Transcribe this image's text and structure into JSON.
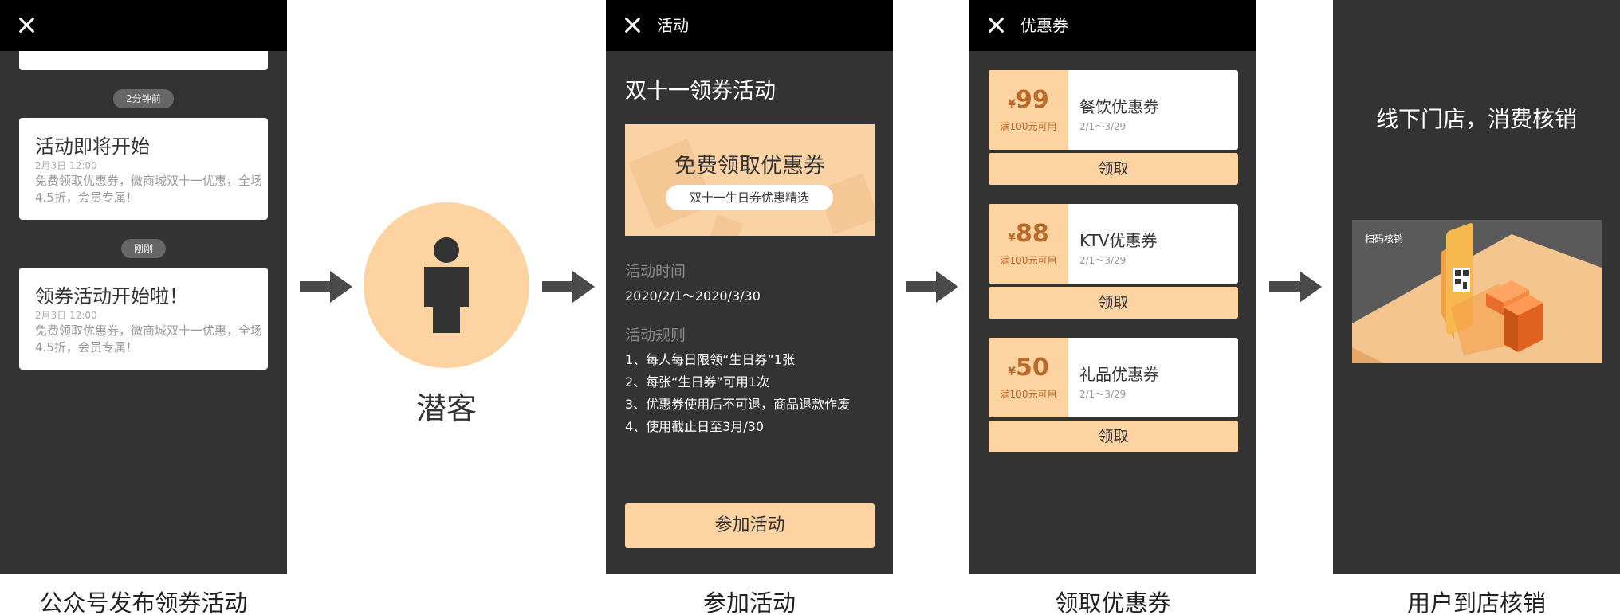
{
  "panel1": {
    "pill_1": "2分钟前",
    "pill_2": "刚刚",
    "messages": [
      {
        "title": "活动即将开始",
        "time": "2月3日 12:00",
        "body": "免费领取优惠券，微商城双十一优惠，全场4.5折，会员专属！"
      },
      {
        "title": "领券活动开始啦！",
        "time": "2月3日 12:00",
        "body": "免费领取优惠券，微商城双十一优惠，全场4.5折，会员专属！"
      }
    ],
    "caption": "公众号发布领券活动"
  },
  "panel2": {
    "label": "潜客"
  },
  "panel3": {
    "topbar_title": "活动",
    "heading": "双十一领券活动",
    "banner_title": "免费领取优惠券",
    "banner_subtitle": "双十一生日券优惠精选",
    "time_label": "活动时间",
    "time_value": "2020/2/1～2020/3/30",
    "rules_label": "活动规则",
    "rules": [
      "1、每人每日限领“生日券”1张",
      "2、每张“生日券”可用1次",
      "3、优惠券使用后不可退，商品退款作废",
      "4、使用截止日至3月/30"
    ],
    "button": "参加活动",
    "caption": "参加活动"
  },
  "panel4": {
    "topbar_title": "优惠券",
    "coupons": [
      {
        "currency": "¥",
        "amount": "99",
        "condition": "满100元可用",
        "name": "餐饮优惠券",
        "date": "2/1～3/29",
        "button": "领取"
      },
      {
        "currency": "¥",
        "amount": "88",
        "condition": "满100元可用",
        "name": "KTV优惠券",
        "date": "2/1～3/29",
        "button": "领取"
      },
      {
        "currency": "¥",
        "amount": "50",
        "condition": "满100元可用",
        "name": "礼品优惠券",
        "date": "2/1～3/29",
        "button": "领取"
      }
    ],
    "caption": "领取优惠券"
  },
  "panel5": {
    "title": "线下门店，消费核销",
    "image_label": "扫码核销",
    "caption": "用户到店核销"
  },
  "colors": {
    "dark": "#333333",
    "bar": "#000000",
    "accent": "#fdd3a2",
    "accent_text": "#b86b2b",
    "arrow": "#4a4a4a"
  }
}
